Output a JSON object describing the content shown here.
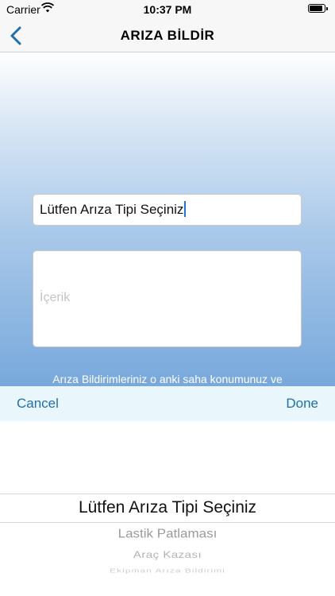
{
  "status_bar": {
    "carrier": "Carrier",
    "time": "10:37 PM"
  },
  "nav": {
    "title": "ARIZA BİLDİR",
    "back_icon": "chevron-left-icon"
  },
  "form": {
    "type_value": "Lütfen Arıza Tipi Seçiniz",
    "content_placeholder": "İçerik",
    "info_text": "Arıza Bildirimleriniz o anki saha konumunuz ve"
  },
  "picker_toolbar": {
    "cancel_label": "Cancel",
    "done_label": "Done"
  },
  "picker": {
    "options": [
      "Lütfen Arıza Tipi Seçiniz",
      "Lastik Patlaması",
      "Araç Kazası",
      "Ekipman Arıza Bildirimi"
    ],
    "selected": "Lütfen Arıza Tipi Seçiniz"
  },
  "colors": {
    "accent": "#1f6fb0",
    "toolbar_bg": "#e9f6fc",
    "gradient_bottom": "#78a8dc"
  }
}
